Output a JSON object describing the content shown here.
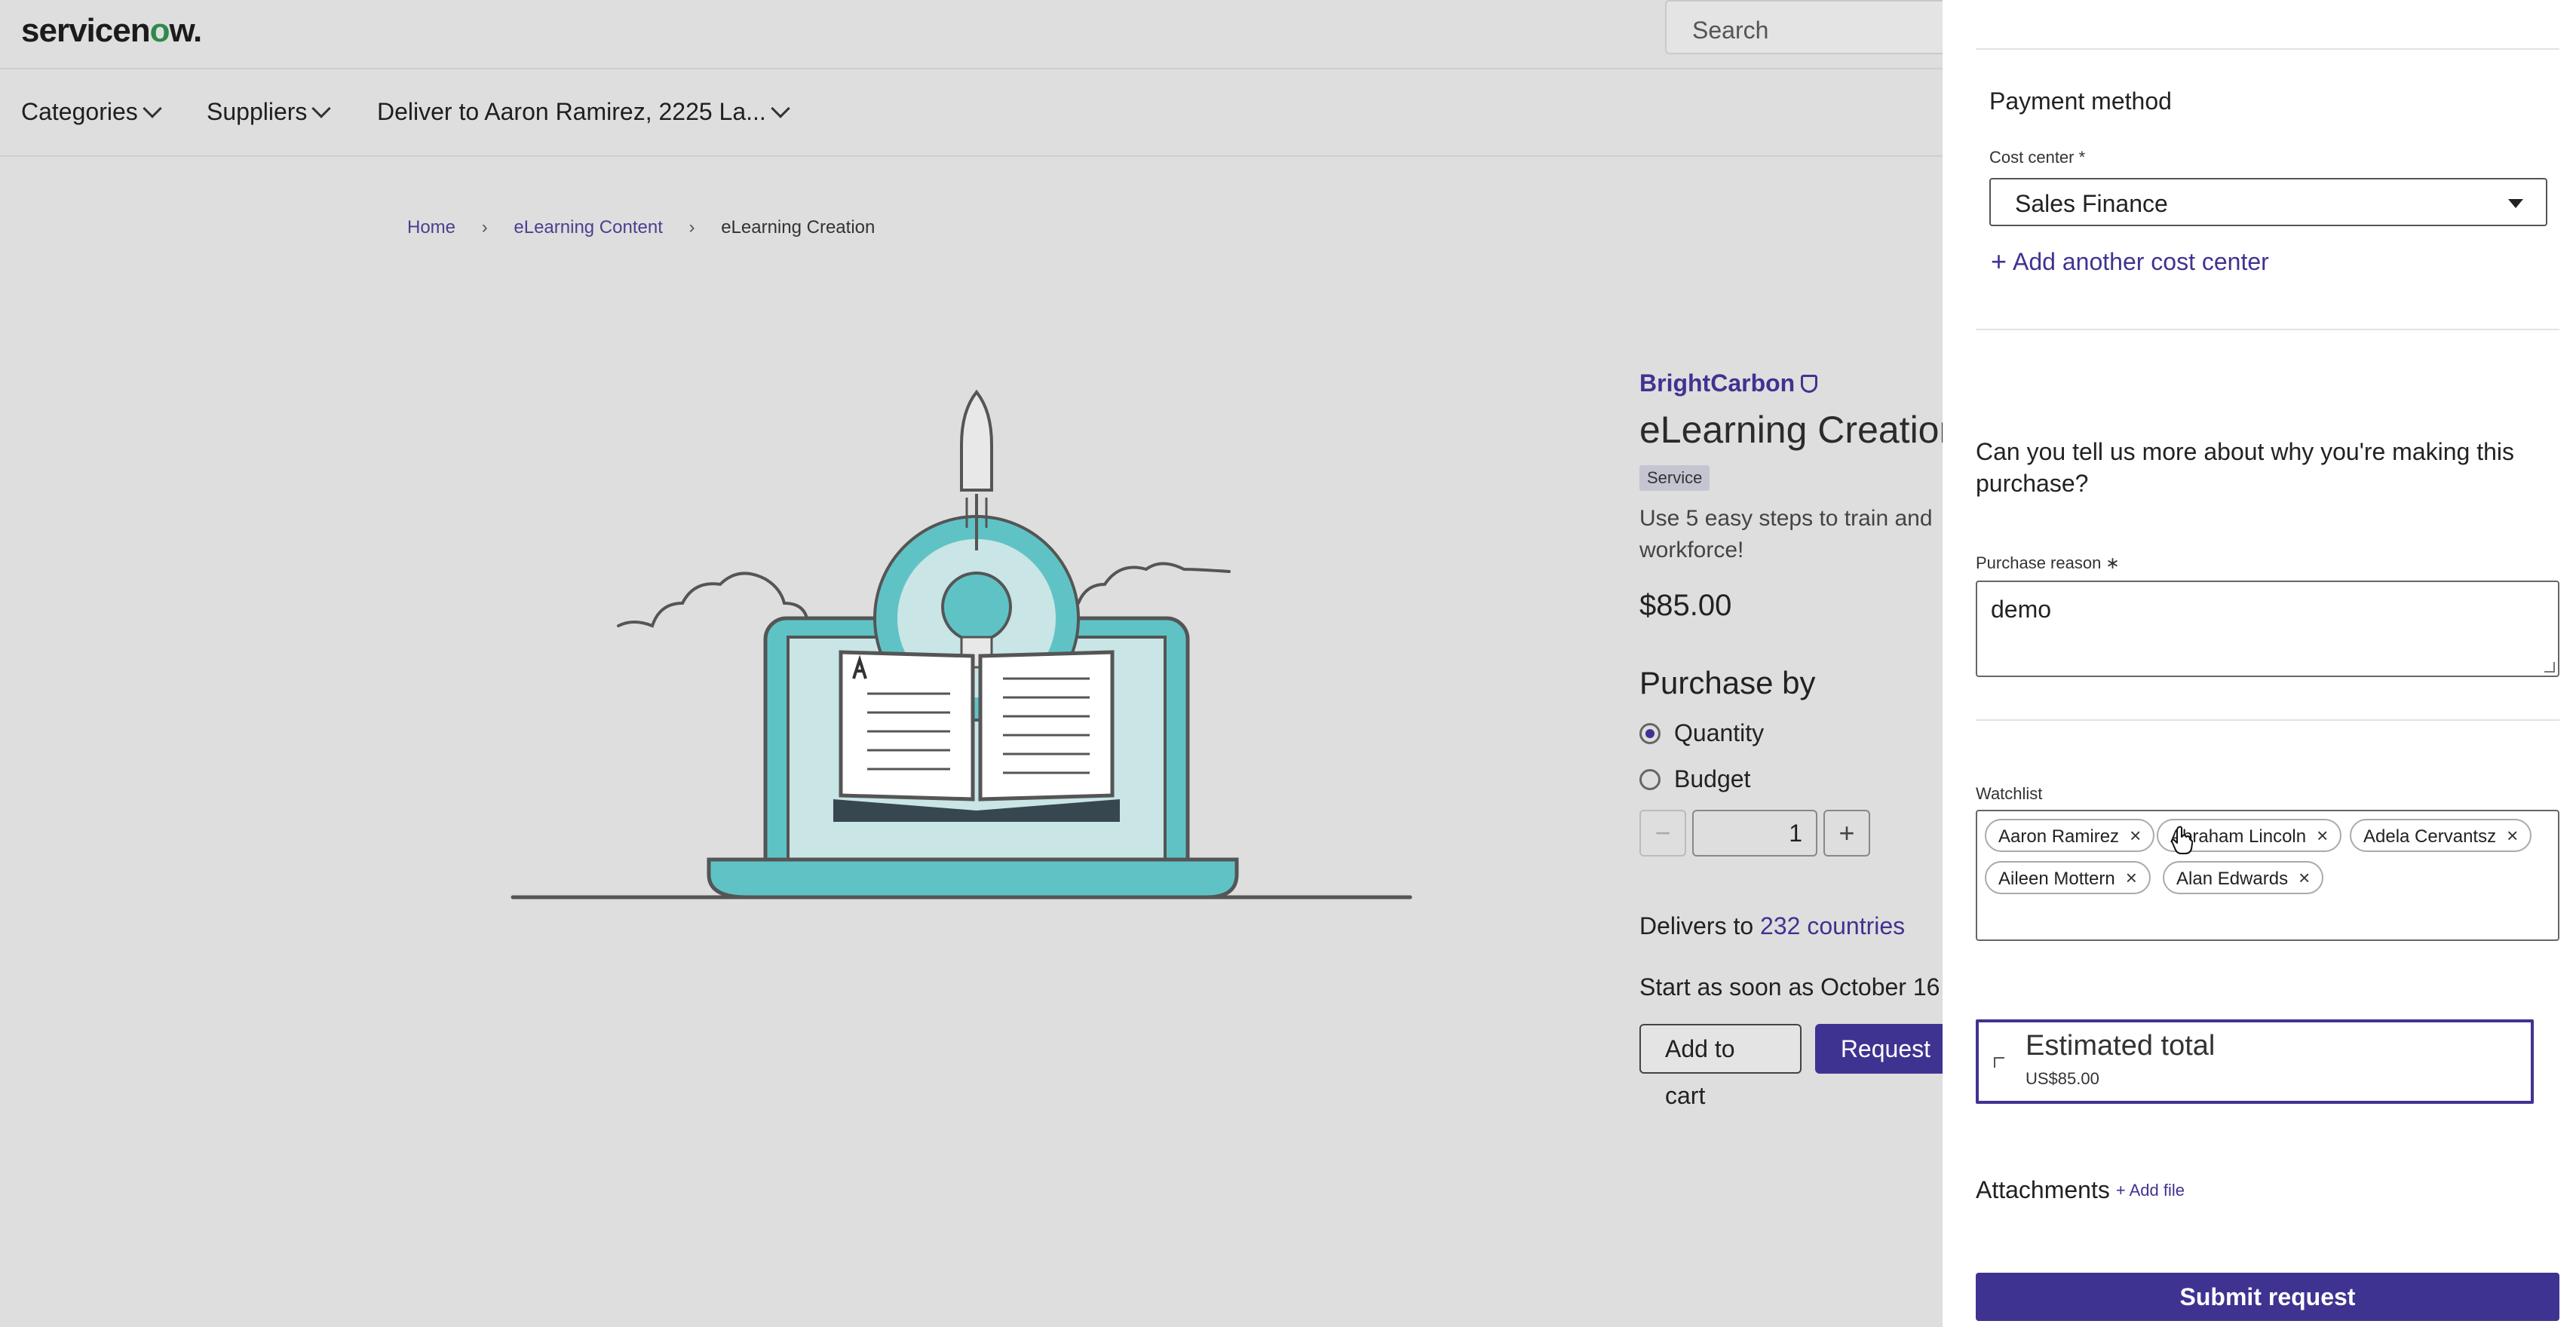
{
  "header": {
    "logo": {
      "prefix": "servicen",
      "dot": "o",
      "suffix": "w."
    },
    "search_placeholder": "Search"
  },
  "nav": {
    "items": [
      {
        "label": "Categories"
      },
      {
        "label": "Suppliers"
      },
      {
        "label": "Deliver to Aaron Ramirez, 2225 La..."
      }
    ]
  },
  "breadcrumb": {
    "home": "Home",
    "category": "eLearning Content",
    "current": "eLearning Creation",
    "separator": "›"
  },
  "product": {
    "vendor": "BrightCarbon",
    "title": "eLearning Creation",
    "badge": "Service",
    "description_line1": "Use 5 easy steps to train and",
    "description_line2": "workforce!",
    "price": "$85.00",
    "purchase_by": "Purchase by",
    "options": [
      {
        "label": "Quantity",
        "selected": true
      },
      {
        "label": "Budget",
        "selected": false
      }
    ],
    "quantity": "1",
    "minus_label": "−",
    "plus_label": "+",
    "delivers_prefix": "Delivers to",
    "delivers_link": "232 countries",
    "start_text": "Start as soon as October 16",
    "add_to_cart": "Add to cart",
    "request": "Request"
  },
  "panel": {
    "payment_method": "Payment method",
    "cost_center_label": "Cost center *",
    "cost_center_value": "Sales Finance",
    "add_cost_center": "Add another cost center",
    "question": "Can you tell us more about why you're making this purchase?",
    "purchase_reason_label": "Purchase reason ∗",
    "purchase_reason_value": "demo",
    "watchlist_label": "Watchlist",
    "watchlist": [
      {
        "name": "Aaron Ramirez"
      },
      {
        "name": "Abraham Lincoln"
      },
      {
        "name": "Adela Cervantsz"
      },
      {
        "name": "Aileen Mottern"
      },
      {
        "name": "Alan Edwards"
      }
    ],
    "chip_remove": "×",
    "estimated_total_label": "Estimated total",
    "estimated_total_value": "US$85.00",
    "attachments": "Attachments",
    "add_file": "+ Add file",
    "submit": "Submit request"
  },
  "colors": {
    "accent": "#3f3391",
    "panel_bg": "#ffffff",
    "page_bg": "#dedede"
  },
  "icons": [
    "chevron-down-icon",
    "verified-shield-icon",
    "plus-icon",
    "close-icon",
    "caret-down-icon",
    "hand-cursor-icon"
  ]
}
